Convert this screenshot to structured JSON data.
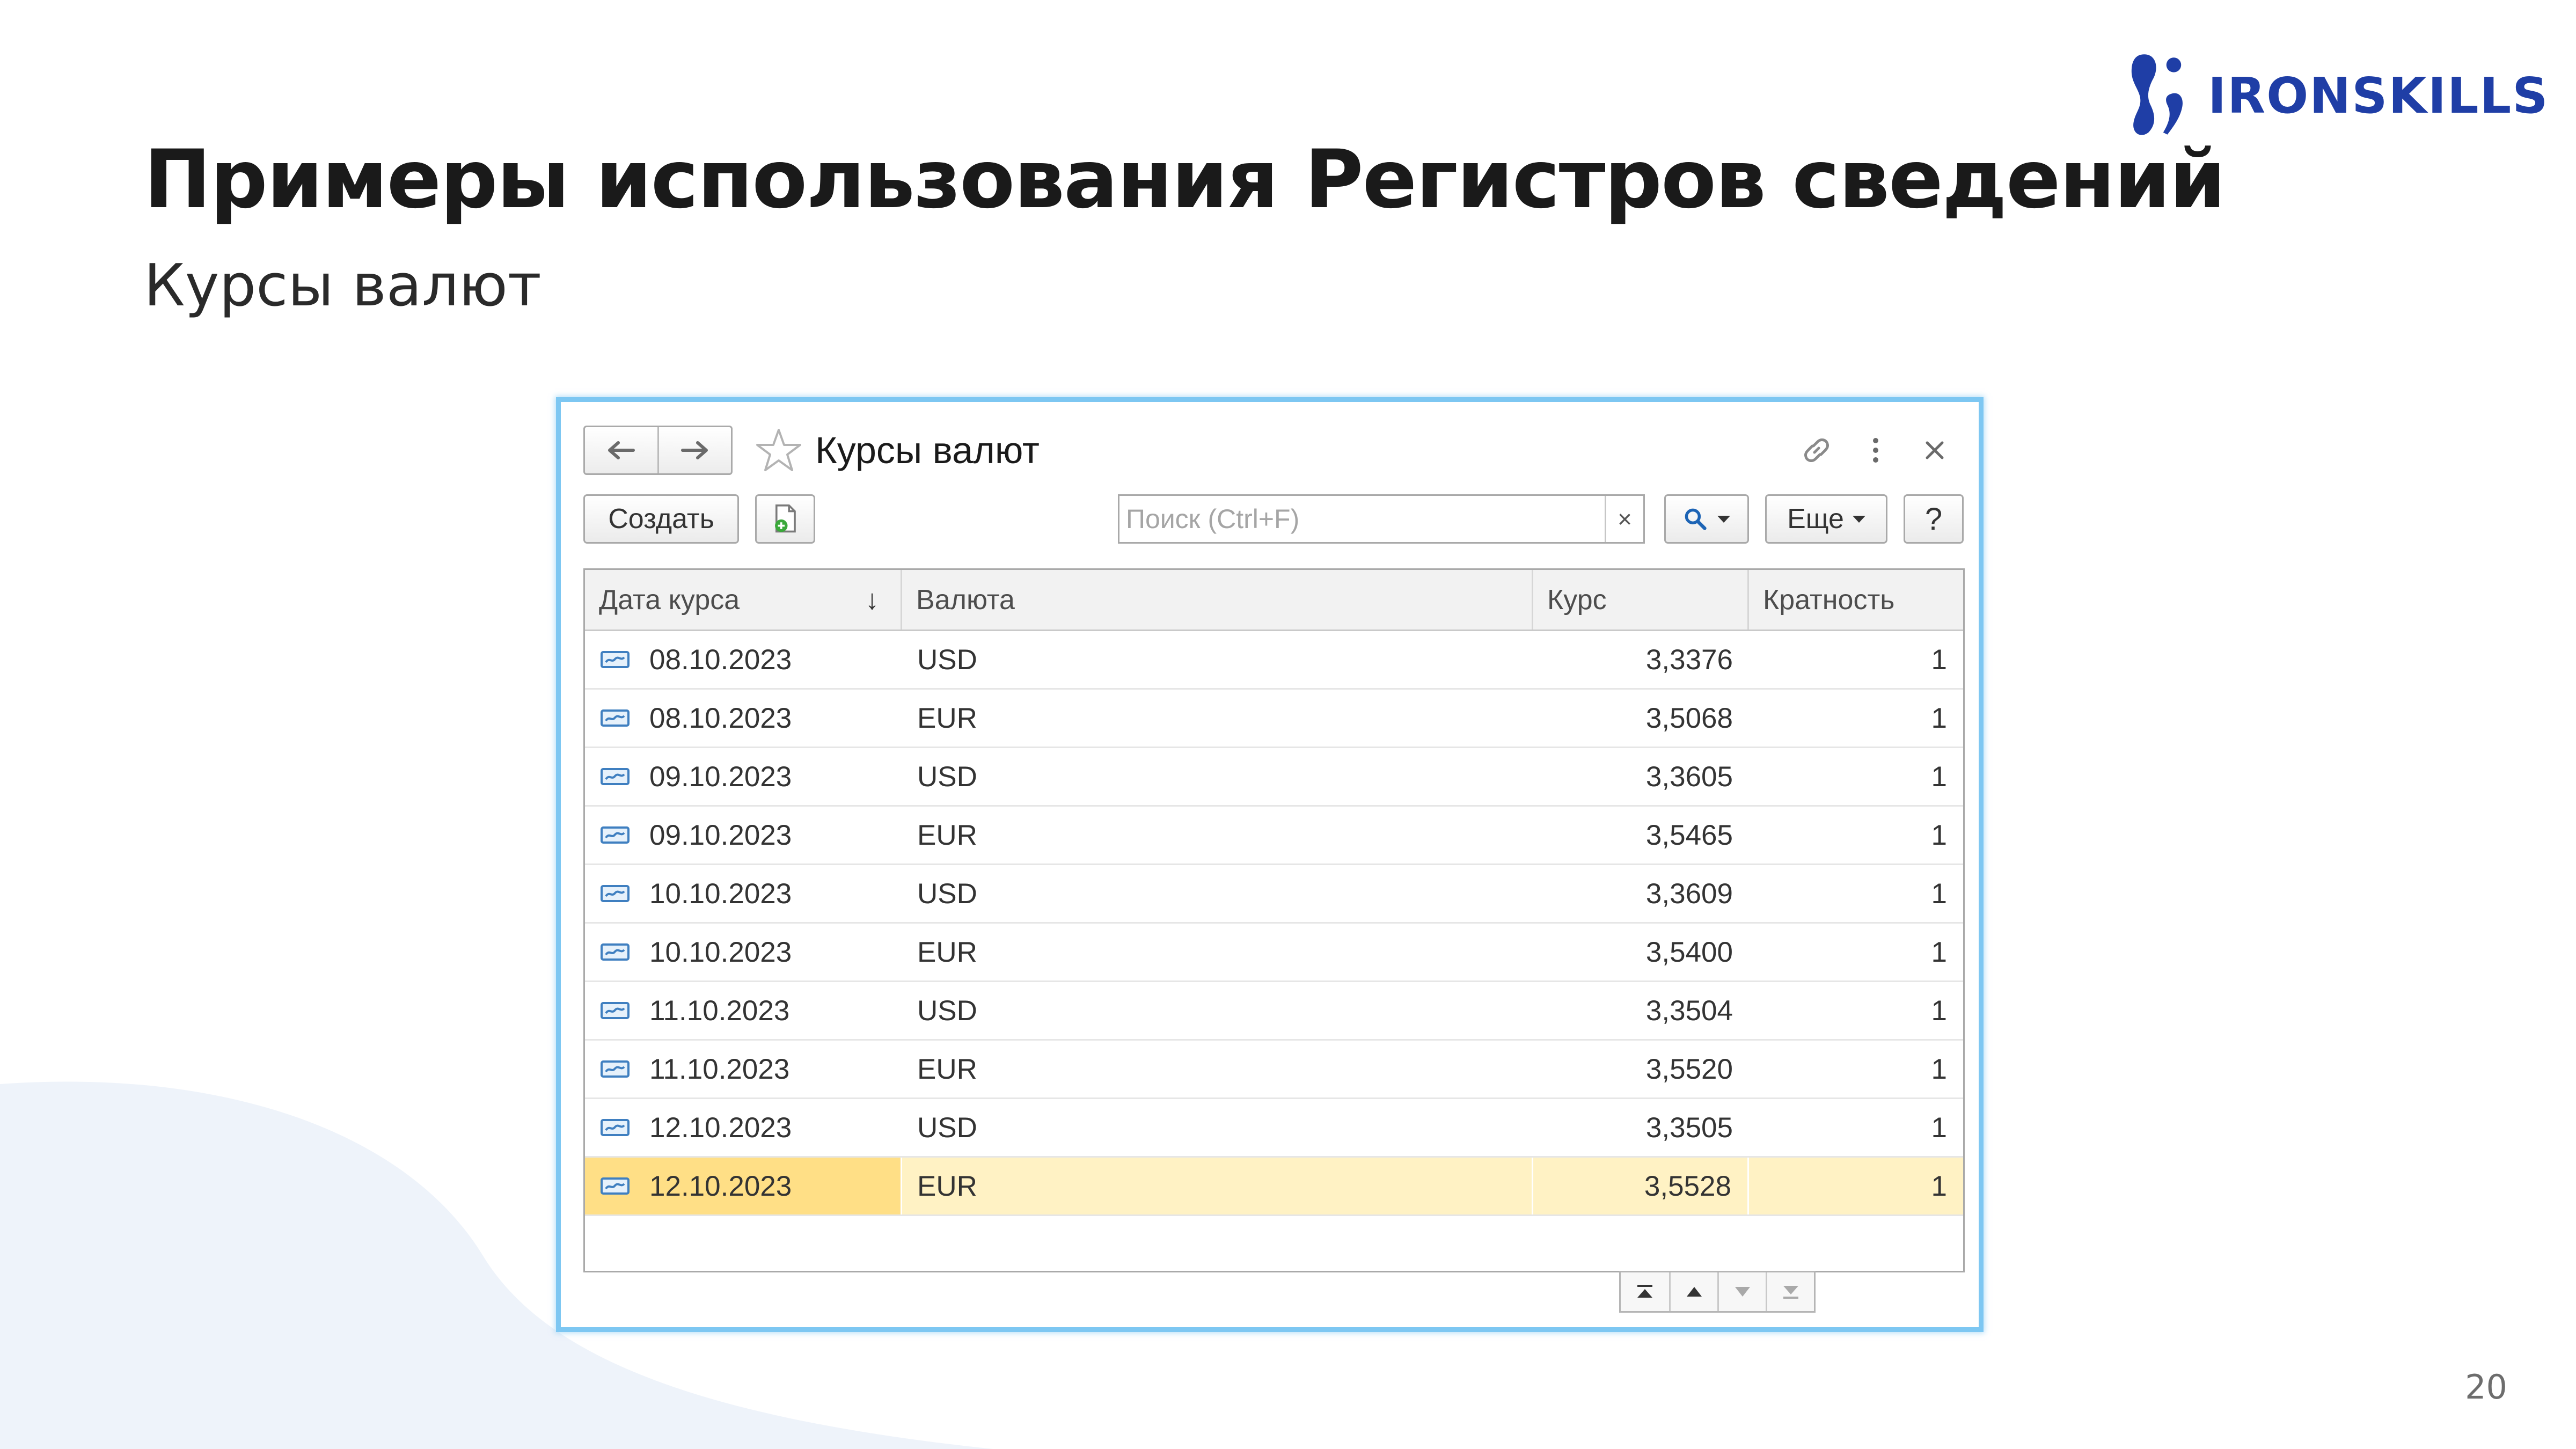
{
  "slide": {
    "title": "Примеры использования Регистров сведений",
    "subtitle": "Курсы валют",
    "page_number": "20",
    "logo_text": "IRONSKILLS"
  },
  "window": {
    "title": "Курсы валют",
    "nav": {
      "back_icon": "arrow-left-icon",
      "forward_icon": "arrow-right-icon"
    },
    "actions": [
      "link-icon",
      "more-vertical-icon",
      "close-icon"
    ]
  },
  "toolbar": {
    "create_label": "Создать",
    "copy_icon": "copy-document-icon",
    "search_placeholder": "Поиск (Ctrl+F)",
    "search_value": "",
    "clear_label": "×",
    "more_label": "Еще",
    "help_label": "?"
  },
  "table": {
    "columns": [
      "Дата курса",
      "Валюта",
      "Курс",
      "Кратность"
    ],
    "sort_indicator": "↓",
    "rows": [
      {
        "date": "08.10.2023",
        "currency": "USD",
        "rate": "3,3376",
        "multiplicity": "1"
      },
      {
        "date": "08.10.2023",
        "currency": "EUR",
        "rate": "3,5068",
        "multiplicity": "1"
      },
      {
        "date": "09.10.2023",
        "currency": "USD",
        "rate": "3,3605",
        "multiplicity": "1"
      },
      {
        "date": "09.10.2023",
        "currency": "EUR",
        "rate": "3,5465",
        "multiplicity": "1"
      },
      {
        "date": "10.10.2023",
        "currency": "USD",
        "rate": "3,3609",
        "multiplicity": "1"
      },
      {
        "date": "10.10.2023",
        "currency": "EUR",
        "rate": "3,5400",
        "multiplicity": "1"
      },
      {
        "date": "11.10.2023",
        "currency": "USD",
        "rate": "3,3504",
        "multiplicity": "1"
      },
      {
        "date": "11.10.2023",
        "currency": "EUR",
        "rate": "3,5520",
        "multiplicity": "1"
      },
      {
        "date": "12.10.2023",
        "currency": "USD",
        "rate": "3,3505",
        "multiplicity": "1"
      },
      {
        "date": "12.10.2023",
        "currency": "EUR",
        "rate": "3,5528",
        "multiplicity": "1"
      }
    ],
    "selected_row": 9
  },
  "colors": {
    "accent_border": "#7dc7f2",
    "logo_blue": "#1f3ea6",
    "selected_row": "#fff2c4",
    "selected_cell": "#ffdf86"
  }
}
